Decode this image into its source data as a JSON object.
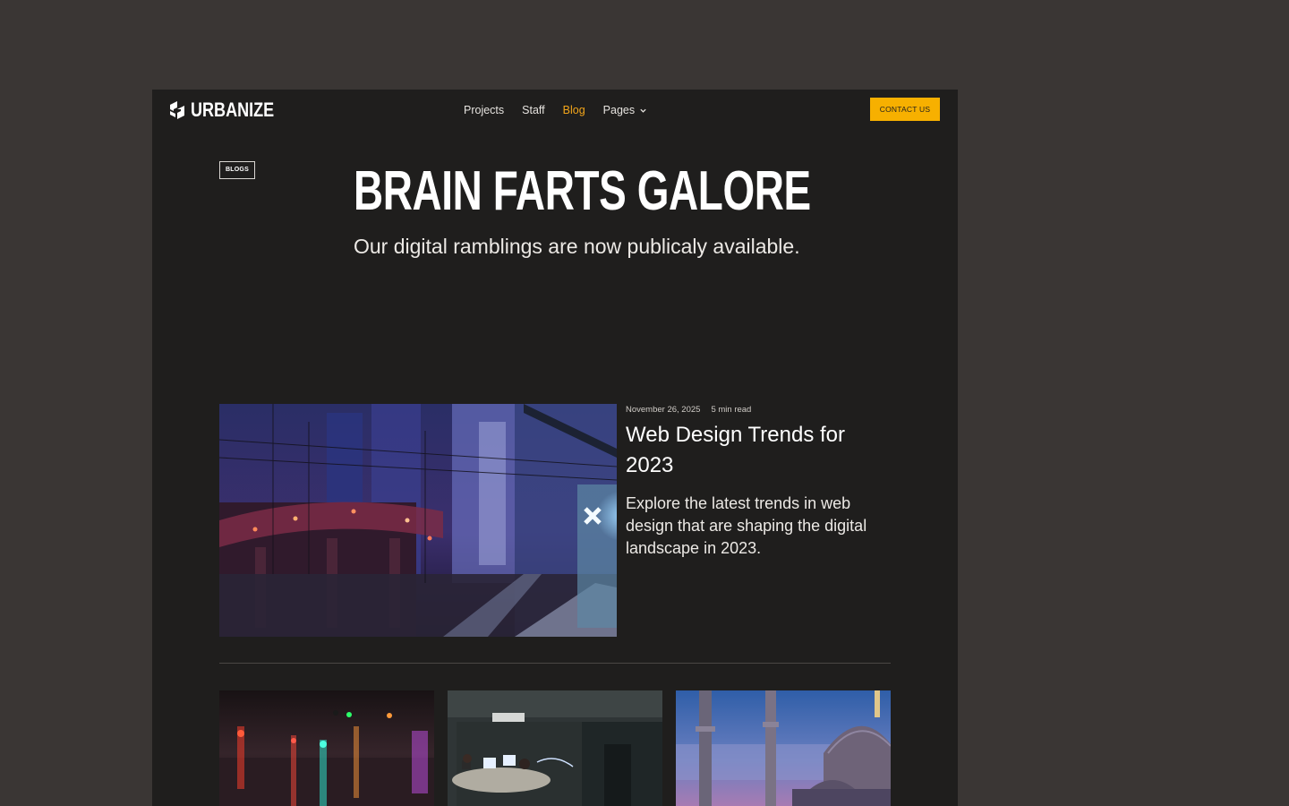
{
  "brand": {
    "name": "URBANIZE"
  },
  "nav": {
    "items": [
      {
        "label": "Projects",
        "active": false
      },
      {
        "label": "Staff",
        "active": false
      },
      {
        "label": "Blog",
        "active": true
      },
      {
        "label": "Pages",
        "active": false,
        "has_dropdown": true
      }
    ],
    "cta_label": "CONTACT US"
  },
  "hero": {
    "tag": "BLOGS",
    "title": "BRAIN FARTS GALORE",
    "subtitle": "Our digital ramblings are now publicaly available."
  },
  "featured_post": {
    "date": "November 26, 2025",
    "read_time": "5  min read",
    "title": "Web Design Trends for 2023",
    "excerpt": "Explore the latest trends in web design that are shaping the digital landscape in 2023."
  },
  "colors": {
    "page_background": "#3a3634",
    "frame_background": "#1f1e1d",
    "accent": "#f2a51a",
    "cta_background": "#f7b000",
    "text_primary": "#ffffff"
  },
  "icons": {
    "logo": "urbanize-logo-icon",
    "dropdown": "chevron-down-icon"
  }
}
